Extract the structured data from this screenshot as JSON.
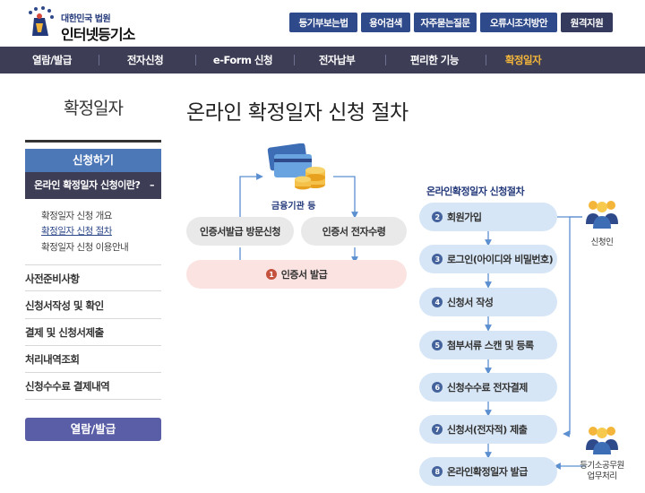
{
  "header": {
    "logo_sub": "대한민국 법원",
    "logo_main": "인터넷등기소",
    "util_links": [
      "등기부보는법",
      "용어검색",
      "자주묻는질문",
      "오류시조치방안",
      "원격지원"
    ]
  },
  "gnb": {
    "items": [
      "열람/발급",
      "전자신청",
      "e-Form 신청",
      "전자납부",
      "편리한 기능",
      "확정일자"
    ],
    "active_index": 5
  },
  "sidebar": {
    "title": "확정일자",
    "section_head": "신청하기",
    "active_sub": "온라인 확정일자 신청이란?",
    "active_sub_suffix": "–",
    "sub_links": [
      "확정일자 신청 개요",
      "확정일자 신청 절차",
      "확정일자 신청 이용안내"
    ],
    "current_link_index": 1,
    "menus": [
      "사전준비사항",
      "신청서작성 및 확인",
      "결제 및 신청서제출",
      "처리내역조회",
      "신청수수료 결제내역"
    ],
    "button": "열람/발급"
  },
  "main": {
    "title": "온라인 확정일자 신청 절차",
    "finance_label": "금융기관 등",
    "cert_visit": "인증서발급 방문신청",
    "cert_receive": "인증서 전자수령",
    "cert_issue": {
      "num": "1",
      "label": "인증서 발급"
    },
    "flow_title": "온라인확정일자 신청절차",
    "steps": [
      {
        "num": "2",
        "label": "회원가입"
      },
      {
        "num": "3",
        "label": "로그인(아이디와 비밀번호)"
      },
      {
        "num": "4",
        "label": "신청서 작성"
      },
      {
        "num": "5",
        "label": "첨부서류 스캔 및 등록"
      },
      {
        "num": "6",
        "label": "신청수수료 전자결제"
      },
      {
        "num": "7",
        "label": "신청서(전자적) 제출"
      },
      {
        "num": "8",
        "label": "온라인확정일자 발급"
      }
    ],
    "applicant_label": "신청인",
    "official_label_1": "등기소공무원",
    "official_label_2": "업무처리"
  },
  "colors": {
    "navy": "#3d3e56",
    "blue_head": "#4d78b8",
    "accent_orange": "#f4b63a",
    "step_bg": "#d7e6f6",
    "cert_pink": "#fbe3e1"
  }
}
